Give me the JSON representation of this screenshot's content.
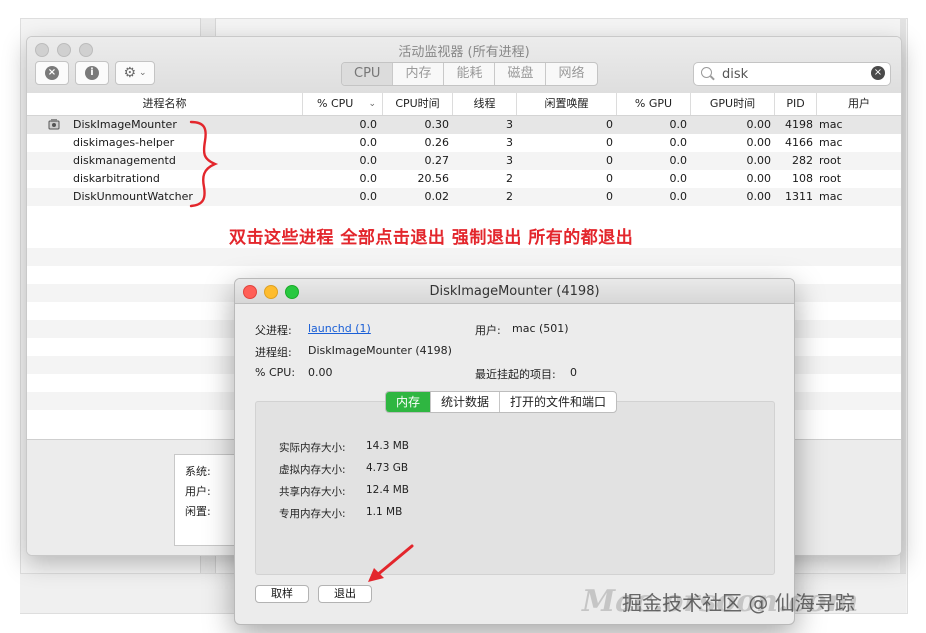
{
  "window": {
    "title": "活动监视器 (所有进程)",
    "toolbar": {
      "close_process": "×",
      "info": "i",
      "gear": "⚙",
      "gear_caret": "⌄"
    },
    "tabs": [
      {
        "label": "CPU",
        "active": true
      },
      {
        "label": "内存",
        "active": false
      },
      {
        "label": "能耗",
        "active": false
      },
      {
        "label": "磁盘",
        "active": false
      },
      {
        "label": "网络",
        "active": false
      }
    ],
    "search": {
      "value": "disk",
      "clear": "×"
    }
  },
  "table": {
    "headers": {
      "name": "进程名称",
      "cpu": "% CPU",
      "cpu_sort": "⌄",
      "cpu_time": "CPU时间",
      "threads": "线程",
      "idle_wakeups": "闲置唤醒",
      "gpu": "% GPU",
      "gpu_time": "GPU时间",
      "pid": "PID",
      "user": "用户"
    },
    "rows": [
      {
        "name": "DiskImageMounter",
        "cpu": "0.0",
        "cpu_time": "0.30",
        "threads": "3",
        "idle": "0",
        "gpu": "0.0",
        "gpu_time": "0.00",
        "pid": "4198",
        "user": "mac"
      },
      {
        "name": "diskimages-helper",
        "cpu": "0.0",
        "cpu_time": "0.26",
        "threads": "3",
        "idle": "0",
        "gpu": "0.0",
        "gpu_time": "0.00",
        "pid": "4166",
        "user": "mac"
      },
      {
        "name": "diskmanagementd",
        "cpu": "0.0",
        "cpu_time": "0.27",
        "threads": "3",
        "idle": "0",
        "gpu": "0.0",
        "gpu_time": "0.00",
        "pid": "282",
        "user": "root"
      },
      {
        "name": "diskarbitrationd",
        "cpu": "0.0",
        "cpu_time": "20.56",
        "threads": "2",
        "idle": "0",
        "gpu": "0.0",
        "gpu_time": "0.00",
        "pid": "108",
        "user": "root"
      },
      {
        "name": "DiskUnmountWatcher",
        "cpu": "0.0",
        "cpu_time": "0.02",
        "threads": "2",
        "idle": "0",
        "gpu": "0.0",
        "gpu_time": "0.00",
        "pid": "1311",
        "user": "mac"
      }
    ]
  },
  "annotation": "双击这些进程 全部点击退出 强制退出 所有的都退出",
  "bottom_panel": {
    "system": "系统:",
    "user": "用户:",
    "idle": "闲置:"
  },
  "inspector": {
    "title": "DiskImageMounter (4198)",
    "parent_label": "父进程:",
    "parent_value": "launchd (1)",
    "user_label": "用户:",
    "user_value": "mac (501)",
    "group_label": "进程组:",
    "group_value": "DiskImageMounter (4198)",
    "cpu_label": "% CPU:",
    "cpu_value": "0.00",
    "hangs_label": "最近挂起的项目:",
    "hangs_value": "0",
    "tabs": [
      "内存",
      "统计数据",
      "打开的文件和端口"
    ],
    "memory": [
      {
        "label": "实际内存大小:",
        "value": "14.3 MB"
      },
      {
        "label": "虚拟内存大小:",
        "value": "4.73 GB"
      },
      {
        "label": "共享内存大小:",
        "value": "12.4 MB"
      },
      {
        "label": "专用内存大小:",
        "value": "1.1 MB"
      }
    ],
    "sample_button": "取样",
    "quit_button": "退出"
  },
  "watermark": {
    "logo": "Mac.orsoon.com",
    "text": "掘金技术社区 @ 仙海寻踪"
  },
  "colors": {
    "annotation": "#e3262c",
    "active_tab": "#2fb641",
    "link": "#1a5fd6"
  }
}
